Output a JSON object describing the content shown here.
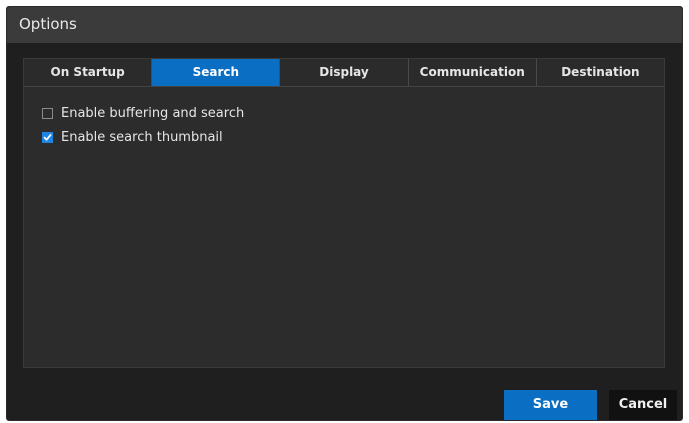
{
  "dialog": {
    "title": "Options"
  },
  "tabs": [
    {
      "label": "On Startup",
      "active": false
    },
    {
      "label": "Search",
      "active": true
    },
    {
      "label": "Display",
      "active": false
    },
    {
      "label": "Communication",
      "active": false
    },
    {
      "label": "Destination",
      "active": false
    }
  ],
  "search_options": [
    {
      "label": "Enable buffering and search",
      "checked": false
    },
    {
      "label": "Enable search thumbnail",
      "checked": true
    }
  ],
  "footer": {
    "save_label": "Save",
    "cancel_label": "Cancel"
  },
  "colors": {
    "accent": "#0a6fc2",
    "background": "#1f1f1f",
    "titlebar": "#3b3b3b",
    "panel": "#2c2c2c"
  }
}
